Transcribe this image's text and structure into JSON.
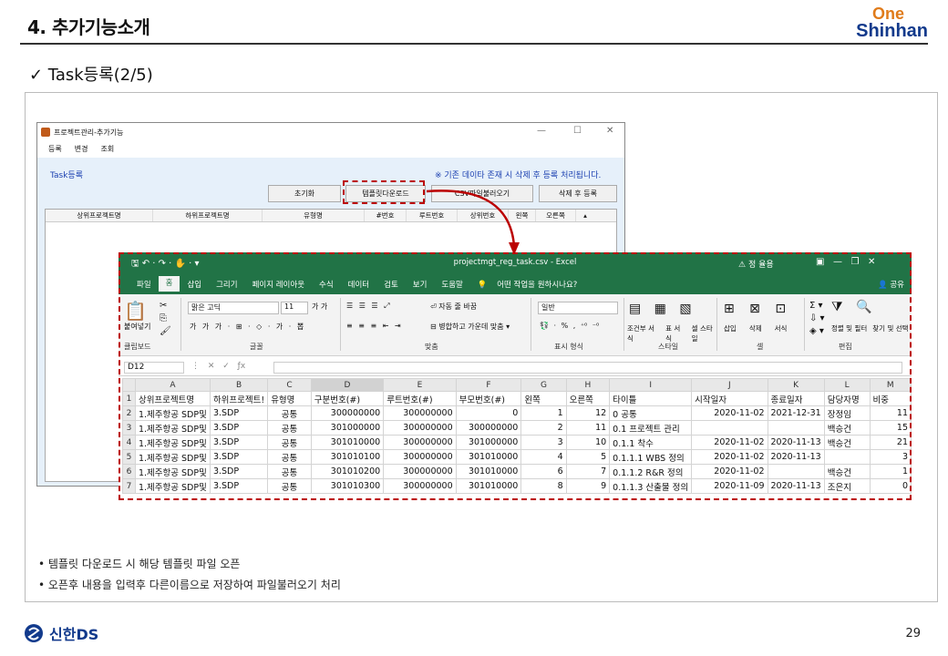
{
  "header": {
    "title": "4. 추가기능소개",
    "logo_top": "One",
    "logo_bottom": "Shinhan"
  },
  "subtitle": "✓  Task등록(2/5)",
  "dialog": {
    "title": "프로젝트관리-추가기능",
    "menu": [
      "등록",
      "변경",
      "조회"
    ],
    "task_label": "Task등록",
    "notice": "※ 기존 데이타 존재 시 삭제 후 등록 처리됩니다.",
    "buttons": [
      "초기화",
      "템플릿다운로드",
      "CSV파일불러오기",
      "삭제 후 등록"
    ],
    "columns": [
      "상위프로젝트명",
      "하위프로젝트명",
      "유형명",
      "#번호",
      "루트번호",
      "상위번호",
      "왼쪽",
      "오른쪽"
    ]
  },
  "excel": {
    "title": "projectmgt_reg_task.csv  -  Excel",
    "user": "정 율용",
    "tabs": [
      "파일",
      "홈",
      "삽입",
      "그리기",
      "페이지 레이아웃",
      "수식",
      "데이터",
      "검토",
      "보기",
      "도움말",
      "어떤 작업을 원하시나요?"
    ],
    "share": "공유",
    "font_name": "맑은 고딕",
    "font_size": "11",
    "wrap": "자동 줄 바꿈",
    "merge": "병합하고 가운데 맞춤",
    "numfmt": "일반",
    "groups": [
      "클립보드",
      "글꼴",
      "맞춤",
      "표시 형식",
      "스타일",
      "셀",
      "편집"
    ],
    "style_buttons": [
      "조건부 서식",
      "표 서식",
      "셀 스타일"
    ],
    "cell_buttons": [
      "삽입",
      "삭제",
      "서식"
    ],
    "edit_buttons": [
      "정렬 및 필터",
      "찾기 및 선택"
    ],
    "paste": "붙여넣기",
    "namebox": "D12",
    "col_letters": [
      "",
      "A",
      "B",
      "C",
      "D",
      "E",
      "F",
      "G",
      "H",
      "I",
      "J",
      "K",
      "L",
      "M"
    ],
    "headers": [
      "상위프로젝트명",
      "하위프로젝트!",
      "유형명",
      "구분번호(#)",
      "루트번호(#)",
      "부모번호(#)",
      "왼쪽",
      "오른쪽",
      "타이틀",
      "시작일자",
      "종료일자",
      "담당자명",
      "비중"
    ],
    "rows": [
      [
        "1.제주항공 SDP및",
        "3.SDP",
        "공통",
        "300000000",
        "300000000",
        "0",
        "1",
        "12",
        "0 공통",
        "2020-11-02",
        "2021-12-31",
        "장정임",
        "11"
      ],
      [
        "1.제주항공 SDP및",
        "3.SDP",
        "공통",
        "301000000",
        "300000000",
        "300000000",
        "2",
        "11",
        "0.1 프로젝트 관리",
        "",
        "",
        "백승건",
        "15"
      ],
      [
        "1.제주항공 SDP및",
        "3.SDP",
        "공통",
        "301010000",
        "300000000",
        "301000000",
        "3",
        "10",
        "0.1.1 착수",
        "2020-11-02",
        "2020-11-13",
        "백승건",
        "21"
      ],
      [
        "1.제주항공 SDP및",
        "3.SDP",
        "공통",
        "301010100",
        "300000000",
        "301010000",
        "4",
        "5",
        "0.1.1.1 WBS 정의",
        "2020-11-02",
        "2020-11-13",
        "",
        "3"
      ],
      [
        "1.제주항공 SDP및",
        "3.SDP",
        "공통",
        "301010200",
        "300000000",
        "301010000",
        "6",
        "7",
        "0.1.1.2 R&R 정의",
        "2020-11-02",
        "",
        "백승건",
        "1"
      ],
      [
        "1.제주항공 SDP및",
        "3.SDP",
        "공통",
        "301010300",
        "300000000",
        "301010000",
        "8",
        "9",
        "0.1.1.3 산출물 정의",
        "2020-11-09",
        "2020-11-13",
        "조은지",
        "0"
      ]
    ]
  },
  "notes": [
    "• 템플릿 다운로드 시 해당 템플릿 파일 오픈",
    "• 오픈후 내용을 입력후 다른이름으로 저장하여 파일불러오기 처리"
  ],
  "footer": {
    "brand": "신한DS",
    "page": "29"
  }
}
